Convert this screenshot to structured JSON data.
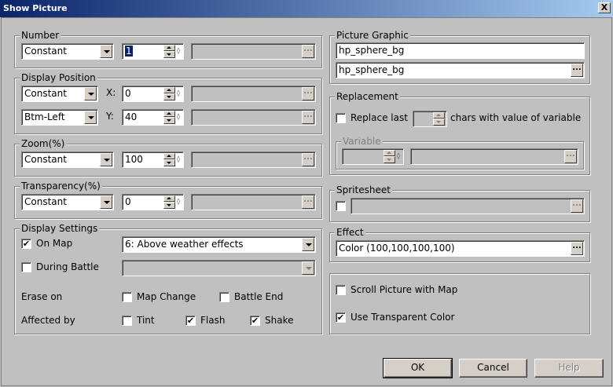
{
  "window": {
    "title": "Show Picture",
    "close": "X"
  },
  "number": {
    "label": "Number",
    "mode": "Constant",
    "value": "1"
  },
  "position": {
    "label": "Display Position",
    "mode": "Constant",
    "x_label": "X:",
    "x_value": "0",
    "anchor": "Btm-Left",
    "y_label": "Y:",
    "y_value": "40"
  },
  "zoom": {
    "label": "Zoom(%)",
    "mode": "Constant",
    "value": "100"
  },
  "transparency": {
    "label": "Transparency(%)",
    "mode": "Constant",
    "value": "0"
  },
  "display": {
    "label": "Display Settings",
    "on_map_label": "On Map",
    "on_map_checked": "✔",
    "layer": "6: Above weather effects",
    "during_battle_label": "During Battle",
    "erase_label": "Erase on",
    "map_change_label": "Map Change",
    "battle_end_label": "Battle End",
    "affected_label": "Affected by",
    "tint_label": "Tint",
    "flash_label": "Flash",
    "flash_checked": "✔",
    "shake_label": "Shake",
    "shake_checked": "✔"
  },
  "picture": {
    "label": "Picture Graphic",
    "name": "hp_sphere_bg",
    "file": "hp_sphere_bg"
  },
  "replacement": {
    "label": "Replacement",
    "replace_label": "Replace last",
    "chars_label": "chars with value of variable",
    "variable_label": "Variable"
  },
  "spritesheet": {
    "label": "Spritesheet"
  },
  "effect": {
    "label": "Effect",
    "value": "Color (100,100,100,100)"
  },
  "options": {
    "scroll_label": "Scroll Picture with Map",
    "transparent_label": "Use Transparent Color",
    "transparent_checked": "✔"
  },
  "buttons": {
    "ok": "OK",
    "cancel": "Cancel",
    "help": "Help"
  },
  "icons": {
    "ellipsis": "...",
    "dropdown": "chevron-down-icon",
    "spinner": "spinner-icon"
  }
}
